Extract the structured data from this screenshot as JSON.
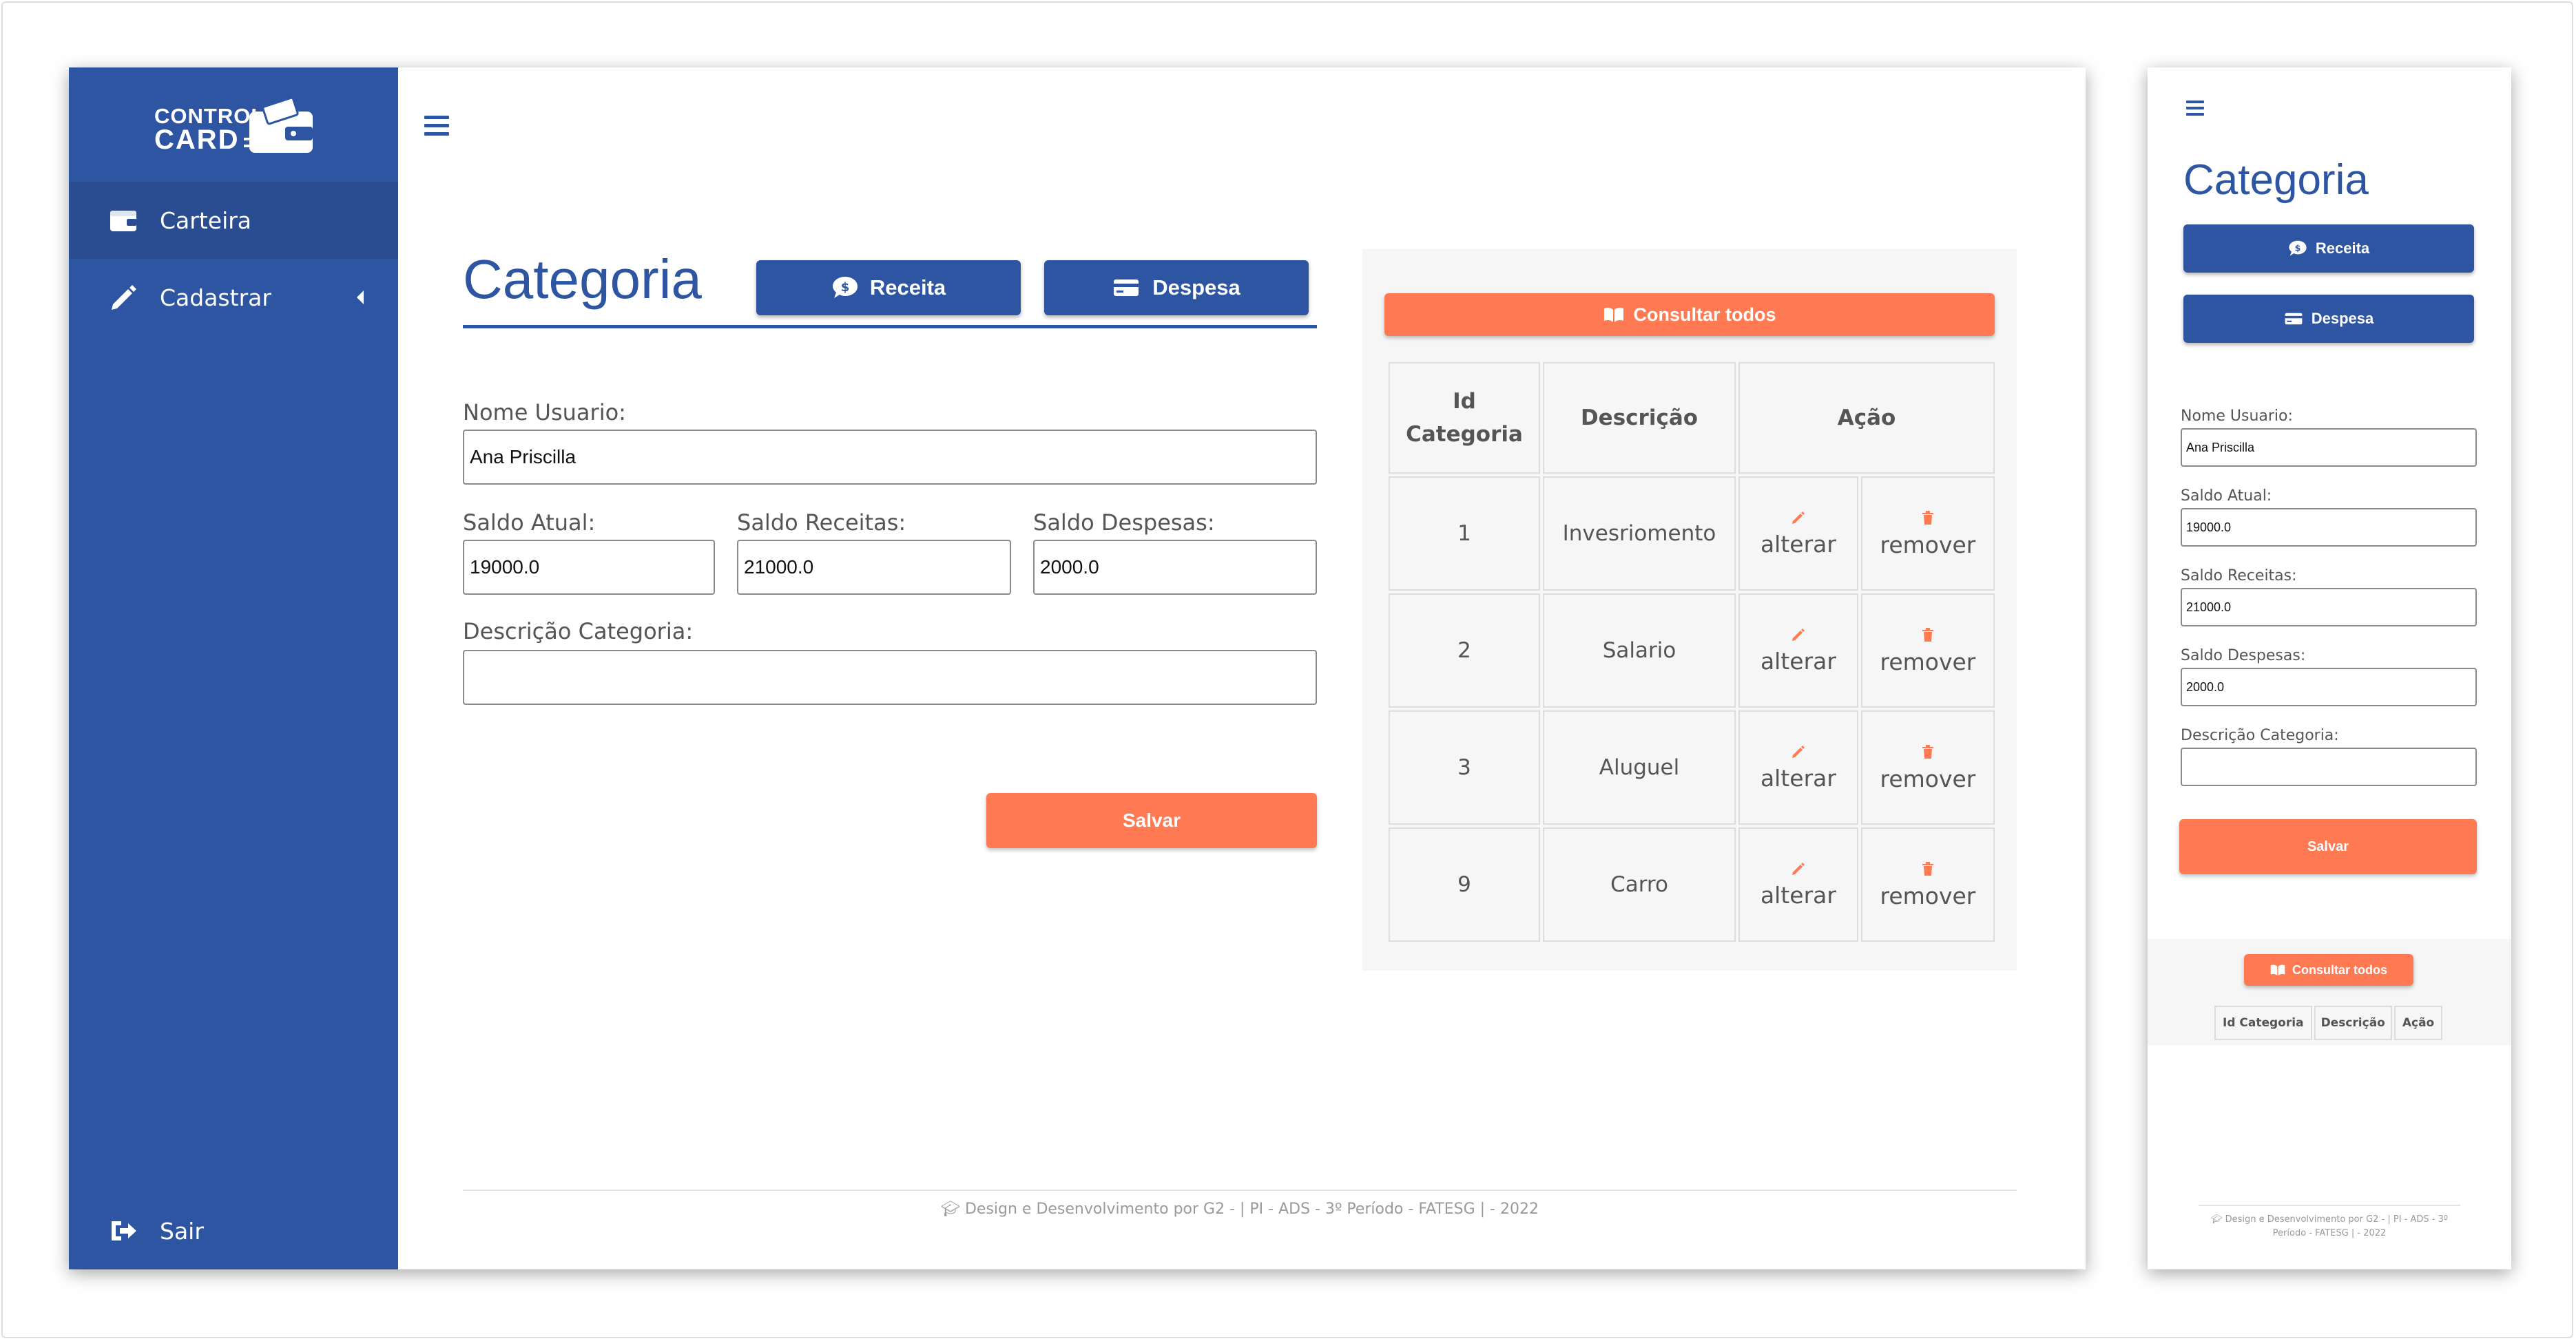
{
  "brand": {
    "line1": "CONTROL",
    "line2": "CARD"
  },
  "nav": {
    "items": [
      {
        "label": "Carteira",
        "icon": "wallet-icon"
      },
      {
        "label": "Cadastrar",
        "icon": "pencil-icon"
      }
    ],
    "logout": {
      "label": "Sair",
      "icon": "sign-out-icon"
    }
  },
  "page": {
    "title": "Categoria",
    "receita_label": "Receita",
    "despesa_label": "Despesa"
  },
  "form": {
    "nome_label": "Nome Usuario:",
    "nome_value": "Ana Priscilla",
    "saldo_atual_label": "Saldo Atual:",
    "saldo_atual_value": "19000.0",
    "saldo_receitas_label": "Saldo Receitas:",
    "saldo_receitas_value": "21000.0",
    "saldo_despesas_label": "Saldo Despesas:",
    "saldo_despesas_value": "2000.0",
    "descricao_label": "Descrição Categoria:",
    "descricao_value": "",
    "salvar_label": "Salvar"
  },
  "table": {
    "consultar_label": "Consultar todos",
    "headers": {
      "id": "Id Categoria",
      "id_line1": "Id",
      "id_line2": "Categoria",
      "descricao": "Descrição",
      "acao": "Ação"
    },
    "alterar_label": "alterar",
    "remover_label": "remover",
    "rows": [
      {
        "id": "1",
        "descricao": "Invesriomento"
      },
      {
        "id": "2",
        "descricao": "Salario"
      },
      {
        "id": "3",
        "descricao": "Aluguel"
      },
      {
        "id": "9",
        "descricao": "Carro"
      }
    ]
  },
  "footer": {
    "text": "Design e Desenvolvimento por G2 - | PI - ADS - 3º Período - FATESG | - 2022",
    "mobile_line1": "Design e Desenvolvimento por G2 - | PI - ADS - 3º",
    "mobile_line2": "Período - FATESG | - 2022"
  },
  "colors": {
    "primary": "#2e55a2",
    "accent": "#ff7a52",
    "panel": "#f6f6f6"
  }
}
